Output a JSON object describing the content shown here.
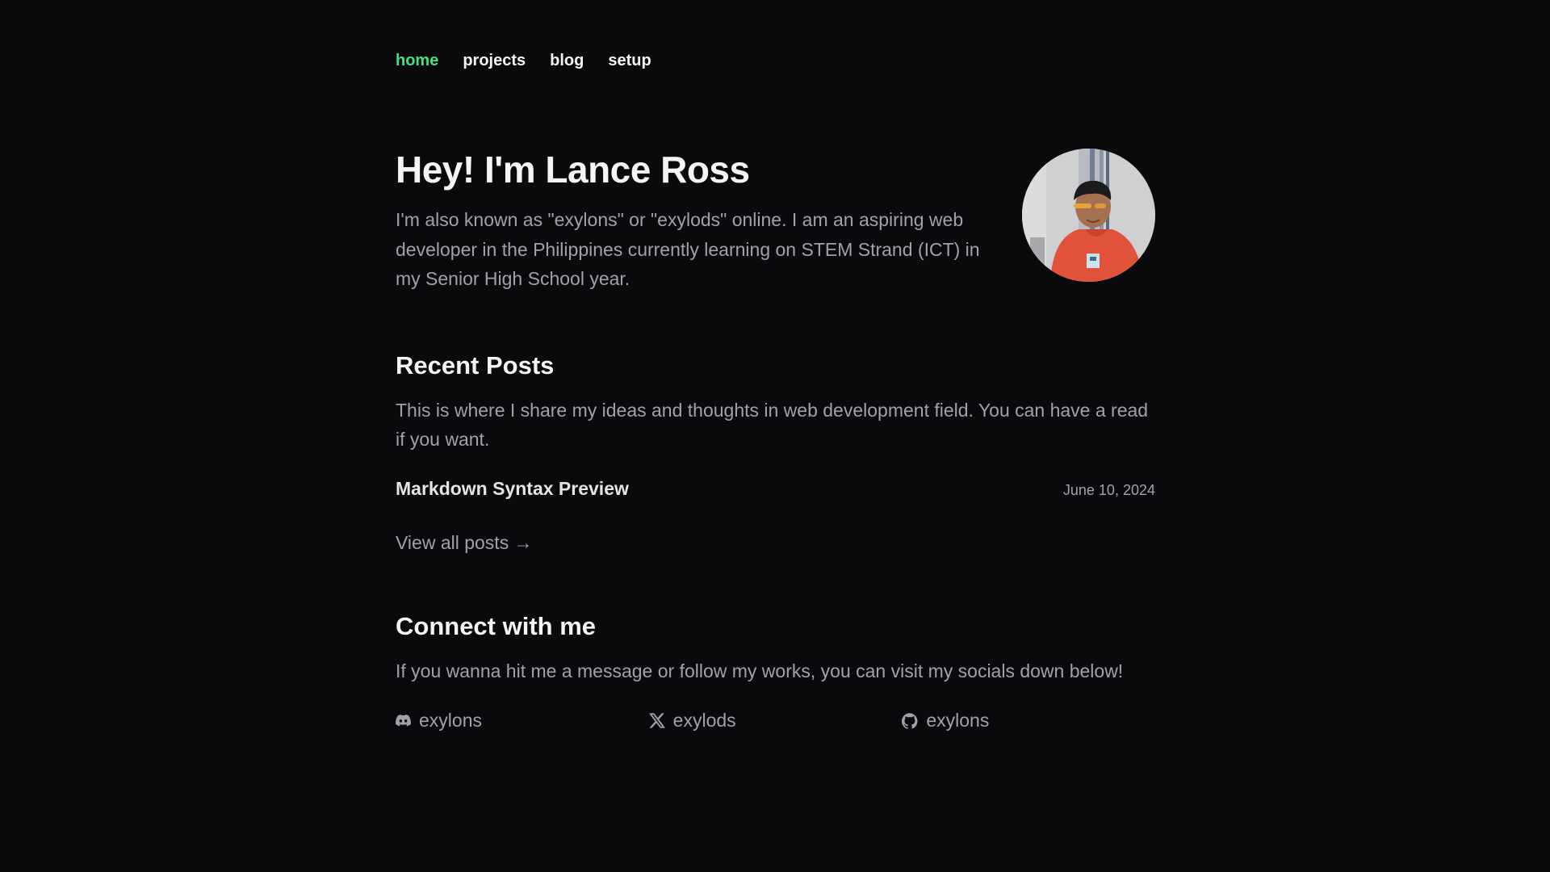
{
  "nav": {
    "items": [
      {
        "label": "home",
        "active": true
      },
      {
        "label": "projects",
        "active": false
      },
      {
        "label": "blog",
        "active": false
      },
      {
        "label": "setup",
        "active": false
      }
    ]
  },
  "hero": {
    "title": "Hey! I'm Lance Ross",
    "description": "I'm also known as \"exylons\" or \"exylods\" online. I am an aspiring web developer in the Philippines currently learning on STEM Strand (ICT) in my Senior High School year."
  },
  "recent_posts": {
    "title": "Recent Posts",
    "description": "This is where I share my ideas and thoughts in web development field. You can have a read if you want.",
    "posts": [
      {
        "title": "Markdown Syntax Preview",
        "date": "June 10, 2024"
      }
    ],
    "view_all_label": "View all posts →"
  },
  "connect": {
    "title": "Connect with me",
    "description": "If you wanna hit me a message or follow my works, you can visit my socials down below!",
    "socials": [
      {
        "icon": "discord-icon",
        "handle": "exylons"
      },
      {
        "icon": "x-icon",
        "handle": "exylods"
      },
      {
        "icon": "github-icon",
        "handle": "exylons"
      }
    ]
  },
  "colors": {
    "background": "#0a0a0d",
    "accent": "#4ade80",
    "text": "#f4f4f5",
    "muted": "#a1a1aa"
  }
}
